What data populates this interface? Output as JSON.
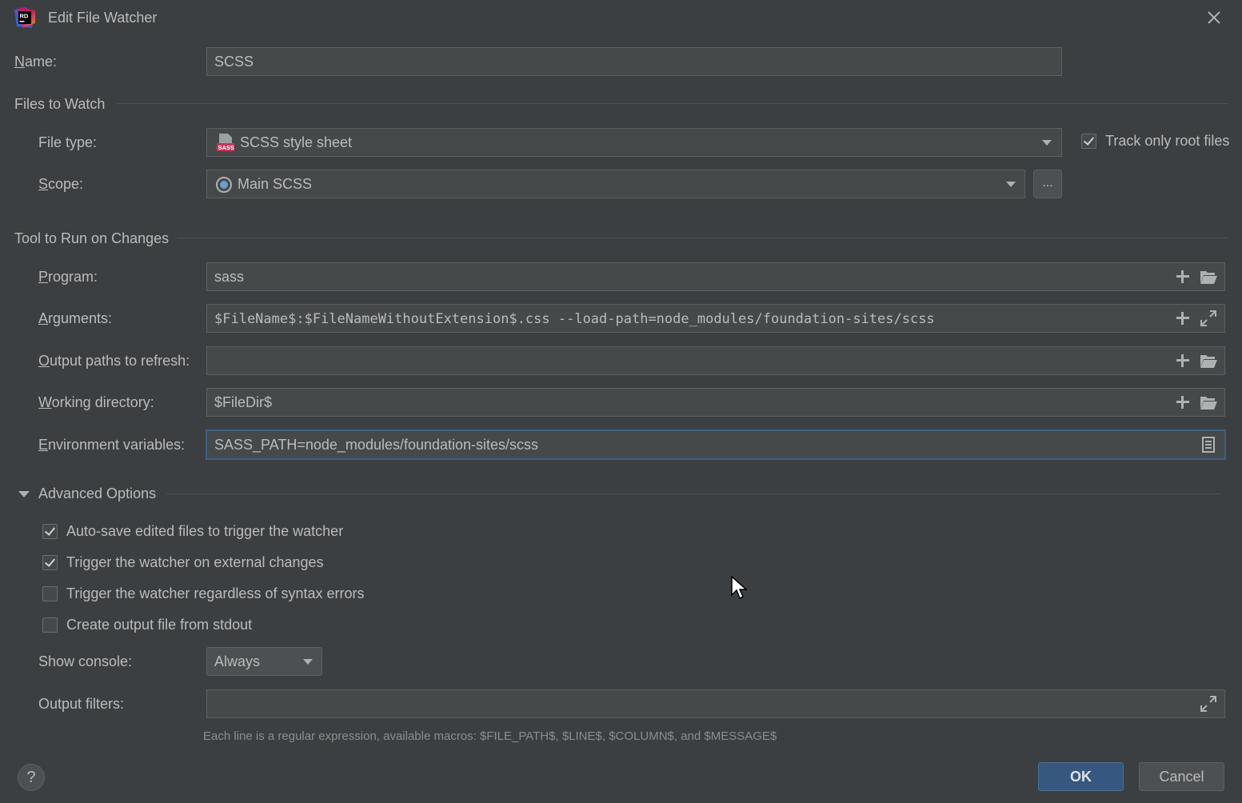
{
  "window": {
    "title": "Edit File Watcher",
    "app_logo_text": "RD"
  },
  "name": {
    "label": "Name:",
    "value": "SCSS"
  },
  "files_to_watch": {
    "section_title": "Files to Watch",
    "file_type_label": "File type:",
    "file_type_value": "SCSS style sheet",
    "file_type_icon_text": "SASS",
    "track_root_label": "Track only root files",
    "track_root_checked": true,
    "scope_label": "Scope:",
    "scope_value": "Main SCSS",
    "scope_more": "..."
  },
  "tool": {
    "section_title": "Tool to Run on Changes",
    "program_label": "Program:",
    "program_value": "sass",
    "arguments_label": "Arguments:",
    "arguments_value": "$FileName$:$FileNameWithoutExtension$.css --load-path=node_modules/foundation-sites/scss",
    "output_paths_label": "Output paths to refresh:",
    "output_paths_value": "",
    "working_dir_label": "Working directory:",
    "working_dir_value": "$FileDir$",
    "env_label": "Environment variables:",
    "env_value": "SASS_PATH=node_modules/foundation-sites/scss"
  },
  "advanced": {
    "section_title": "Advanced Options",
    "options": [
      {
        "label": "Auto-save edited files to trigger the watcher",
        "checked": true
      },
      {
        "label": "Trigger the watcher on external changes",
        "checked": true
      },
      {
        "label": "Trigger the watcher regardless of syntax errors",
        "checked": false
      },
      {
        "label": "Create output file from stdout",
        "checked": false
      }
    ],
    "show_console_label": "Show console:",
    "show_console_value": "Always",
    "output_filters_label": "Output filters:",
    "output_filters_value": "",
    "hint": "Each line is a regular expression, available macros: $FILE_PATH$, $LINE$, $COLUMN$, and $MESSAGE$"
  },
  "footer": {
    "help": "?",
    "ok": "OK",
    "cancel": "Cancel"
  },
  "colors": {
    "background": "#3c3f41",
    "field": "#45494a",
    "accent": "#365880",
    "focus": "#3d6185"
  }
}
